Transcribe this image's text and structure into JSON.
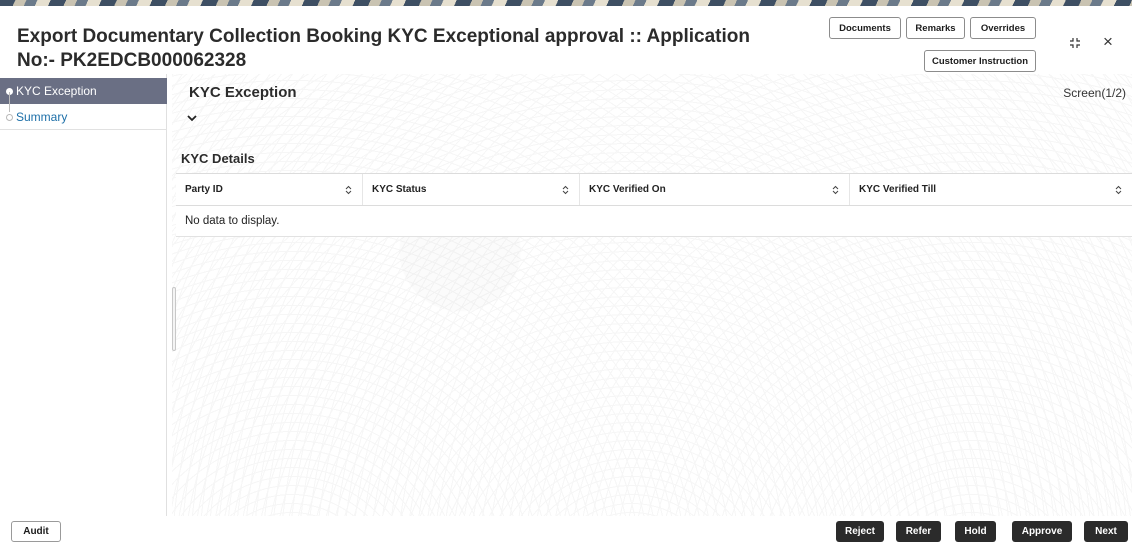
{
  "header": {
    "title": "Export Documentary Collection Booking KYC Exceptional approval :: Application No:- PK2EDCB000062328",
    "buttons": {
      "documents": "Documents",
      "remarks": "Remarks",
      "overrides": "Overrides",
      "customer_instruction": "Customer Instruction"
    },
    "close_glyph": "×"
  },
  "sidebar": {
    "items": [
      {
        "label": "KYC Exception",
        "active": true
      },
      {
        "label": "Summary",
        "active": false
      }
    ]
  },
  "main": {
    "section_title": "KYC Exception",
    "screen_indicator": "Screen(1/2)",
    "kyc_details_label": "KYC Details",
    "table": {
      "columns": [
        "Party ID",
        "KYC Status",
        "KYC Verified On",
        "KYC Verified Till"
      ],
      "empty_message": "No data to display."
    }
  },
  "footer": {
    "audit": "Audit",
    "reject": "Reject",
    "refer": "Refer",
    "hold": "Hold",
    "approve": "Approve",
    "next": "Next"
  },
  "colors": {
    "sidebar_active_bg": "#6a6f84",
    "link_blue": "#1d6fa8",
    "footer_button_bg": "#2b2b2b"
  },
  "icons": [
    "collapse-icon",
    "close-icon",
    "chevron-down-icon",
    "sort-icon"
  ]
}
